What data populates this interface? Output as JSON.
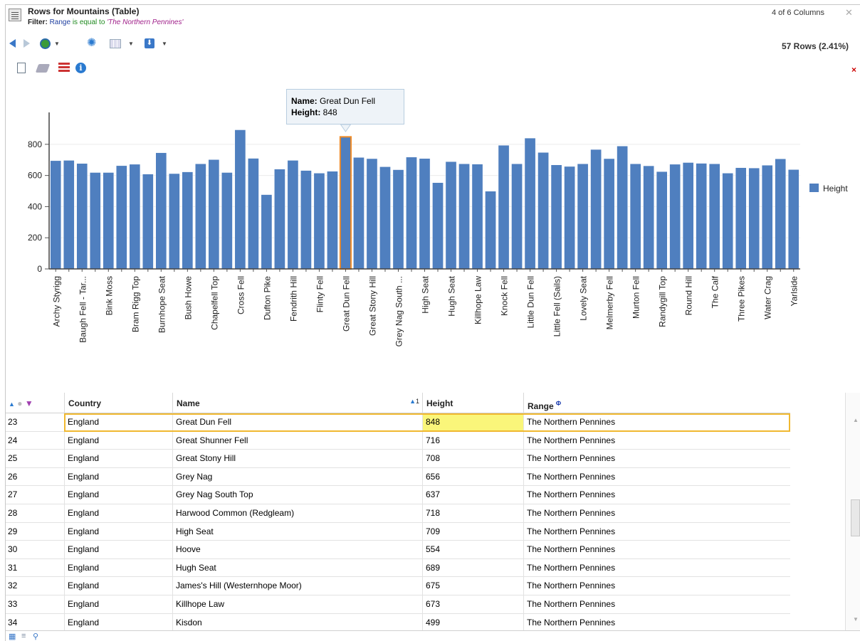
{
  "header": {
    "title": "Rows for Mountains (Table)",
    "filter_label": "Filter:",
    "filter_field": "Range",
    "filter_op": "is equal to",
    "filter_value": "'The Northern Pennines'",
    "columns_info": "4 of 6 Columns",
    "rows_info": "57 Rows (2.41%)"
  },
  "toolbar_icons": [
    "back-arrow-icon",
    "forward-arrow-icon",
    "refresh-icon",
    "settings-gear-icon",
    "table-view-icon",
    "download-icon"
  ],
  "secondary_icons": [
    "new-document-icon",
    "eraser-icon",
    "delete-row-icon",
    "info-icon",
    "close-icon"
  ],
  "tooltip": {
    "name_label": "Name:",
    "name_value": "Great Dun Fell",
    "height_label": "Height:",
    "height_value": "848"
  },
  "chart_data": {
    "type": "bar",
    "ylim": [
      0,
      950
    ],
    "yticks": [
      0,
      200,
      400,
      600,
      800
    ],
    "legend": "Height",
    "legend_position": "right",
    "highlight_index": 22,
    "highlight_color": "#f08c28",
    "bar_color": "#4f7fbf",
    "x_tick_labels": [
      "Archy Styrigg",
      "Baugh Fell - Tar...",
      "Bink Moss",
      "Bram Rigg Top",
      "Burnhope Seat",
      "Bush Howe",
      "Chapelfell Top",
      "Cross Fell",
      "Dufton Pike",
      "Fendrith Hill",
      "Flinty Fell",
      "Great Dun Fell",
      "Great Stony Hill",
      "Grey Nag South ...",
      "High Seat",
      "Hugh Seat",
      "Killhope Law",
      "Knock Fell",
      "Little Dun Fell",
      "Little Fell (Sails)",
      "Lovely Seat",
      "Melmerby Fell",
      "Murton Fell",
      "Randygill Top",
      "Round Hill",
      "The Calf",
      "Three Pikes",
      "Water Crag",
      "Yarlside"
    ],
    "values": [
      695,
      697,
      677,
      619,
      619,
      663,
      672,
      609,
      746,
      612,
      623,
      675,
      702,
      619,
      893,
      710,
      477,
      641,
      697,
      632,
      615,
      627,
      848,
      716,
      708,
      656,
      637,
      718,
      709,
      554,
      689,
      675,
      673,
      499,
      794,
      675,
      840,
      748,
      668,
      658,
      675,
      767,
      708,
      789,
      675,
      662,
      625,
      672,
      683,
      678,
      675,
      615,
      650,
      648,
      666,
      707,
      638
    ]
  },
  "table": {
    "headers": [
      "Country",
      "Name",
      "Height",
      "Range"
    ],
    "name_sort_badge": "1",
    "range_badge": "Φ",
    "rows": [
      [
        "23",
        "England",
        "Great Dun Fell",
        "848",
        "The Northern Pennines"
      ],
      [
        "24",
        "England",
        "Great Shunner Fell",
        "716",
        "The Northern Pennines"
      ],
      [
        "25",
        "England",
        "Great Stony Hill",
        "708",
        "The Northern Pennines"
      ],
      [
        "26",
        "England",
        "Grey Nag",
        "656",
        "The Northern Pennines"
      ],
      [
        "27",
        "England",
        "Grey Nag South Top",
        "637",
        "The Northern Pennines"
      ],
      [
        "28",
        "England",
        "Harwood Common (Redgleam)",
        "718",
        "The Northern Pennines"
      ],
      [
        "29",
        "England",
        "High Seat",
        "709",
        "The Northern Pennines"
      ],
      [
        "30",
        "England",
        "Hoove",
        "554",
        "The Northern Pennines"
      ],
      [
        "31",
        "England",
        "Hugh Seat",
        "689",
        "The Northern Pennines"
      ],
      [
        "32",
        "England",
        "James's Hill (Westernhope Moor)",
        "675",
        "The Northern Pennines"
      ],
      [
        "33",
        "England",
        "Killhope Law",
        "673",
        "The Northern Pennines"
      ],
      [
        "34",
        "England",
        "Kisdon",
        "499",
        "The Northern Pennines"
      ]
    ]
  }
}
